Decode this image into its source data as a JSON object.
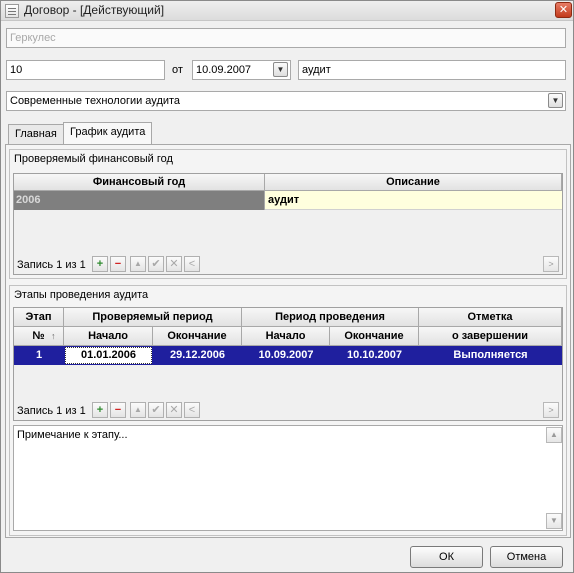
{
  "window": {
    "title": "Договор - [Действующий]",
    "close_glyph": "✕",
    "icon": "document-icon"
  },
  "form": {
    "client": "Геркулес",
    "number": "10",
    "from_label": "от",
    "date": "10.09.2007",
    "type": "аудит",
    "company": "Современные технологии аудита"
  },
  "tabs": [
    {
      "label": "Главная",
      "active": false
    },
    {
      "label": "График аудита",
      "active": true
    }
  ],
  "fiscal": {
    "group_title": "Проверяемый финансовый год",
    "headers": [
      "Финансовый год",
      "Описание"
    ],
    "rows": [
      {
        "year": "2006",
        "description": "аудит"
      }
    ],
    "nav_text": "Запись 1 из 1"
  },
  "stages": {
    "group_title": "Этапы проведения аудита",
    "header_top": [
      "Этап",
      "Проверяемый период",
      "Период проведения",
      "Отметка"
    ],
    "header_bottom": [
      "№",
      "Начало",
      "Окончание",
      "Начало",
      "Окончание",
      "о завершении"
    ],
    "rows": [
      {
        "num": "1",
        "check_start": "01.01.2006",
        "check_end": "29.12.2006",
        "run_start": "10.09.2007",
        "run_end": "10.10.2007",
        "status": "Выполняется"
      }
    ],
    "nav_text": "Запись 1 из 1"
  },
  "note": {
    "text": "Примечание к этапу..."
  },
  "buttons": {
    "ok": "ОК",
    "cancel": "Отмена"
  },
  "glyphs": {
    "add": "+",
    "delete": "−",
    "up": "▲",
    "save": "✔",
    "cancel_edit": "✕",
    "left": "<",
    "right": ">",
    "sort": "↑",
    "dropdown": "▼"
  },
  "colors": {
    "selection": "#1f1f9e",
    "year_cell_bg": "#7f7f7f",
    "year_cell_fg": "#d8d8d8",
    "description_bg": "#ffffde"
  }
}
